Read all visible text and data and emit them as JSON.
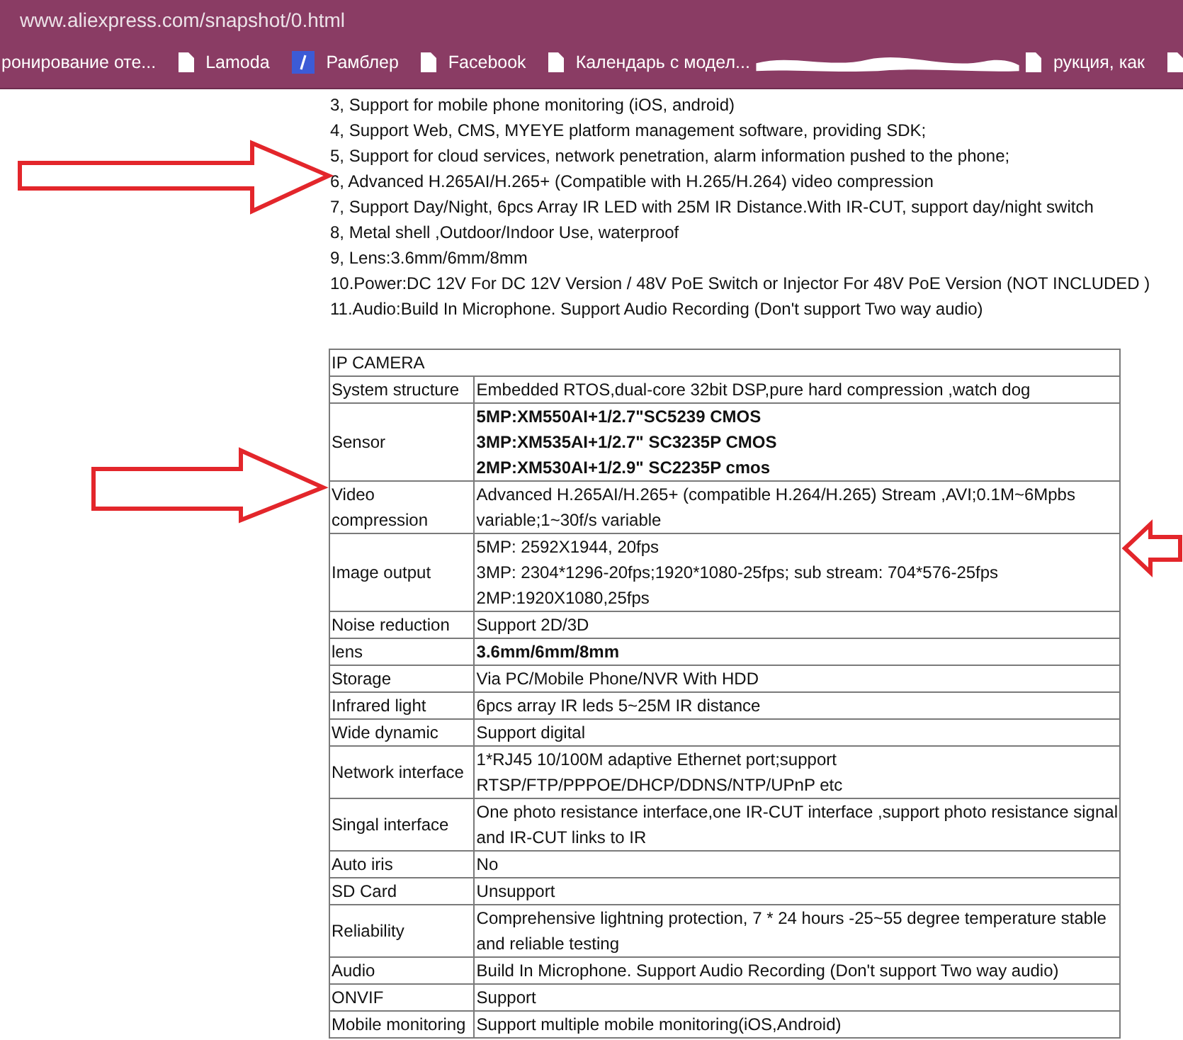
{
  "address_bar": {
    "url": "www.aliexpress.com/snapshot/0.html"
  },
  "bookmarks": [
    {
      "label": "ронирование оте...",
      "kind": "none"
    },
    {
      "label": "Lamoda",
      "kind": "page"
    },
    {
      "label": "Рамблер",
      "kind": "slash"
    },
    {
      "label": "Facebook",
      "kind": "page"
    },
    {
      "label": "Календарь с модел...",
      "kind": "page"
    },
    {
      "label": "рукция, как",
      "kind": "redacted"
    },
    {
      "kind": "page"
    }
  ],
  "features": [
    "3,  Support for mobile phone monitoring (iOS, android)",
    "4,  Support Web, CMS, MYEYE platform management software, providing SDK;",
    "5,  Support for cloud services, network penetration, alarm information pushed to the phone;",
    "6,   Advanced H.265AI/H.265+ (Compatible with H.265/H.264) video compression",
    "7,  Support Day/Night, 6pcs Array IR LED with 25M IR Distance.With IR-CUT, support day/night switch",
    "8, Metal shell ,Outdoor/Indoor Use, waterproof",
    "9, Lens:3.6mm/6mm/8mm",
    "10.Power:DC 12V For DC 12V Version / 48V PoE Switch or Injector For 48V PoE Version (NOT INCLUDED )",
    "11.Audio:Build In Microphone. Support Audio Recording (Don't support Two way audio)"
  ],
  "spec_table": {
    "title": "IP  CAMERA",
    "rows": [
      {
        "label": "System structure",
        "bold": false,
        "lines": [
          "Embedded RTOS,dual-core 32bit DSP,pure hard compression ,watch dog"
        ]
      },
      {
        "label": "Sensor",
        "bold": true,
        "lines": [
          "5MP:XM550AI+1/2.7\"SC5239 CMOS",
          "3MP:XM535AI+1/2.7\" SC3235P CMOS",
          "2MP:XM530AI+1/2.9\" SC2235P cmos"
        ]
      },
      {
        "label": "Video compression",
        "bold": false,
        "lines": [
          "Advanced H.265AI/H.265+ (compatible H.264/H.265) Stream ,AVI;0.1M~6Mpbs",
          "variable;1~30f/s variable"
        ]
      },
      {
        "label": "Image output",
        "bold": false,
        "lines": [
          "5MP: 2592X1944, 20fps",
          "3MP: 2304*1296-20fps;1920*1080-25fps; sub stream: 704*576-25fps",
          "2MP:1920X1080,25fps"
        ]
      },
      {
        "label": "Noise reduction",
        "bold": false,
        "lines": [
          "Support 2D/3D"
        ]
      },
      {
        "label": "lens",
        "bold": true,
        "lines": [
          "3.6mm/6mm/8mm"
        ]
      },
      {
        "label": "Storage",
        "bold": false,
        "lines": [
          "Via PC/Mobile Phone/NVR With HDD"
        ]
      },
      {
        "label": "Infrared light",
        "bold": false,
        "lines": [
          "6pcs array IR leds 5~25M IR distance"
        ]
      },
      {
        "label": "Wide dynamic",
        "bold": false,
        "lines": [
          "Support digital"
        ]
      },
      {
        "label": "Network interface",
        "bold": false,
        "lines": [
          "1*RJ45 10/100M adaptive Ethernet port;support",
          "RTSP/FTP/PPPOE/DHCP/DDNS/NTP/UPnP etc"
        ]
      },
      {
        "label": "Singal interface",
        "bold": false,
        "lines": [
          "One photo resistance interface,one IR-CUT interface ,support photo resistance signal",
          "and IR-CUT links to IR"
        ]
      },
      {
        "label": "Auto iris",
        "bold": false,
        "lines": [
          "No"
        ]
      },
      {
        "label": "SD Card",
        "bold": false,
        "lines": [
          "Unsupport"
        ]
      },
      {
        "label": "Reliability",
        "bold": false,
        "lines": [
          "Comprehensive lightning protection, 7 * 24 hours -25~55 degree temperature stable",
          "and reliable testing"
        ]
      },
      {
        "label": "Audio",
        "bold": false,
        "lines": [
          "Build In Microphone. Support Audio Recording (Don't support Two way audio)"
        ]
      },
      {
        "label": "ONVIF",
        "bold": false,
        "lines": [
          "Support"
        ]
      },
      {
        "label": "Mobile monitoring",
        "bold": false,
        "lines": [
          "Support multiple mobile monitoring(iOS,Android)"
        ]
      }
    ]
  }
}
